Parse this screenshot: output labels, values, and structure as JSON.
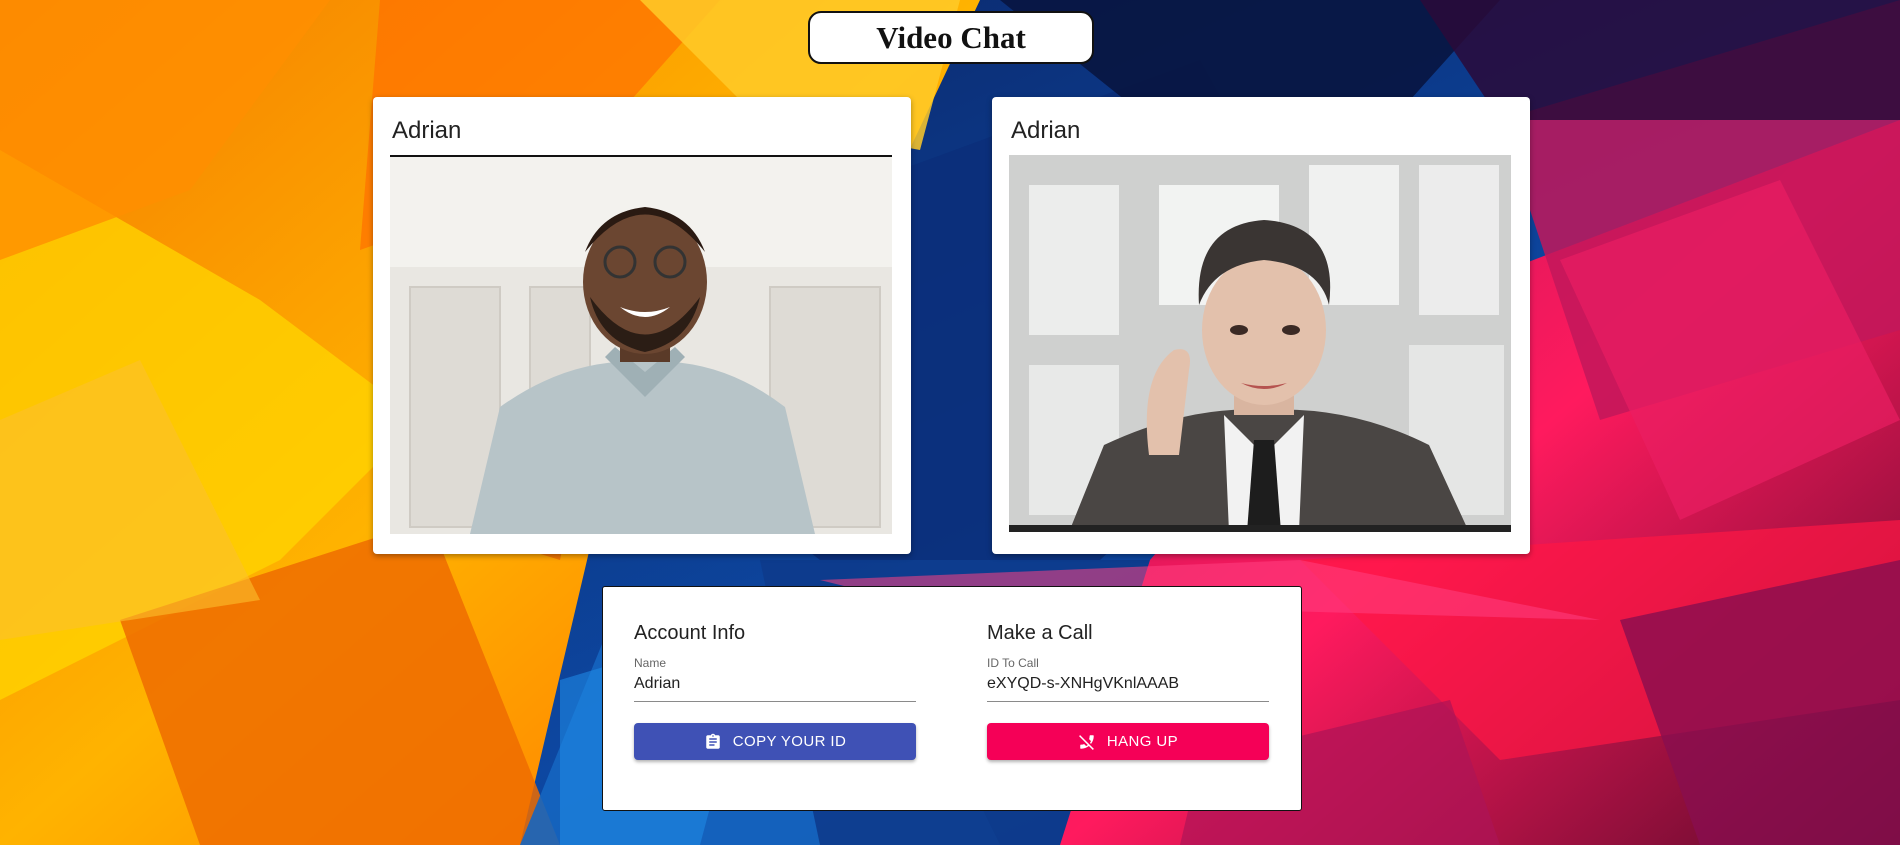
{
  "app": {
    "title": "Video Chat"
  },
  "videos": [
    {
      "name": "Adrian"
    },
    {
      "name": "Adrian"
    }
  ],
  "account": {
    "heading": "Account Info",
    "name_label": "Name",
    "name_value": "Adrian",
    "copy_button": "COPY YOUR ID",
    "copy_icon": "clipboard-icon"
  },
  "call": {
    "heading": "Make a Call",
    "id_label": "ID To Call",
    "id_value": "eXYQD-s-XNHgVKnlAAAB",
    "hangup_button": "HANG UP",
    "hangup_icon": "phone-disabled-icon"
  },
  "colors": {
    "copy_button": "#3f51b5",
    "hangup_button": "#f50057"
  }
}
